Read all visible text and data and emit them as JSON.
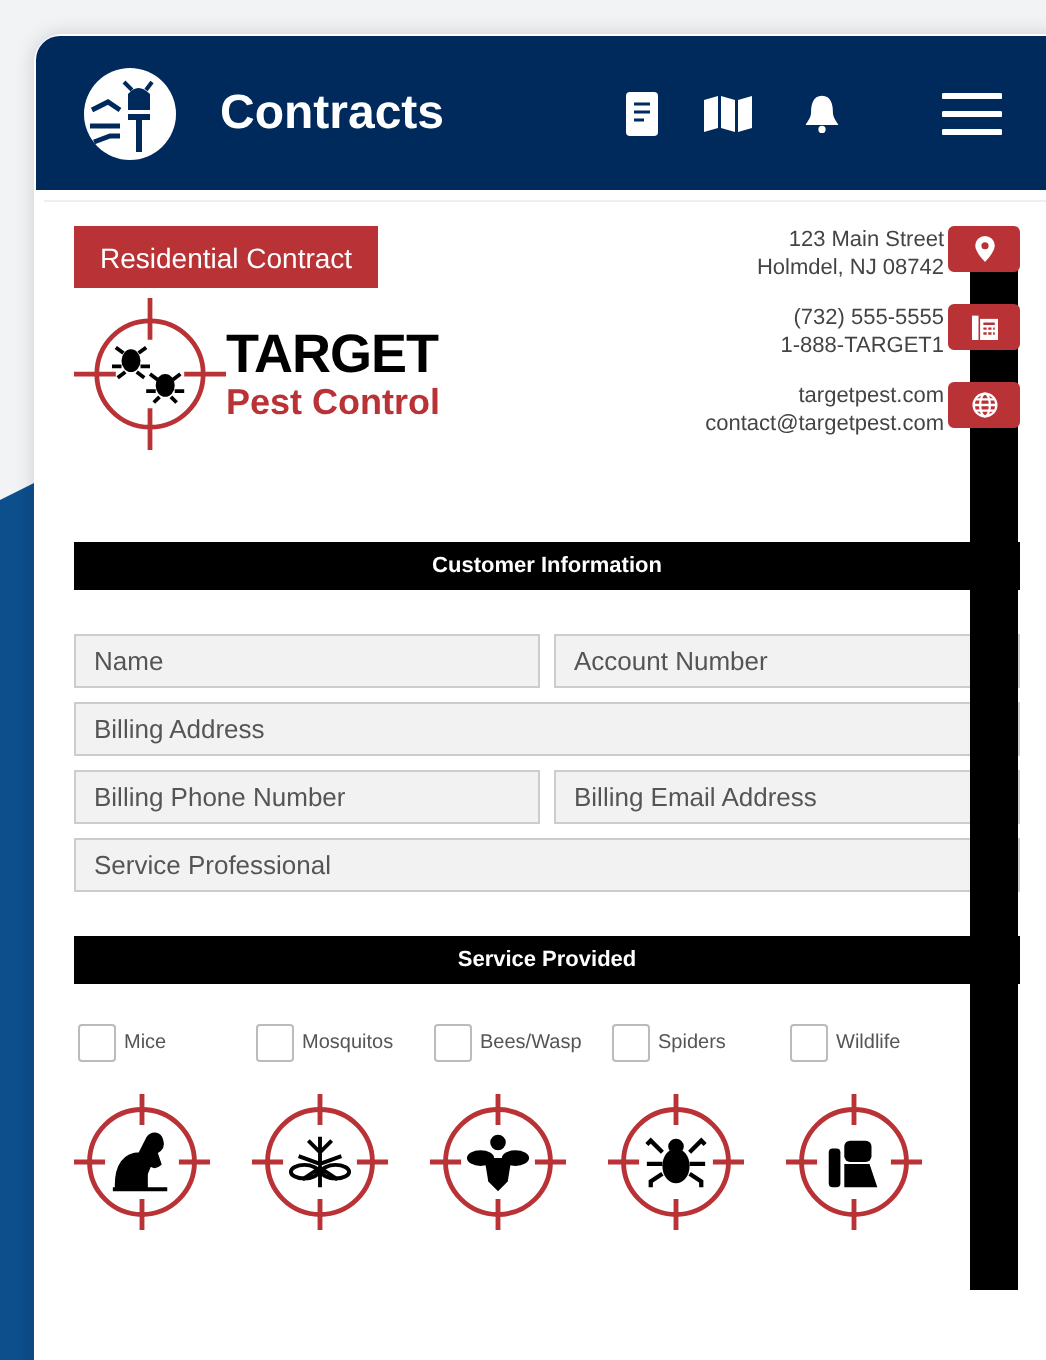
{
  "app_bar": {
    "title": "Contracts"
  },
  "contract_type": "Residential Contract",
  "brand": {
    "name": "TARGET",
    "tagline": "Pest Control"
  },
  "contacts": [
    {
      "kind": "address",
      "lines": [
        "123 Main Street",
        "Holmdel, NJ 08742"
      ]
    },
    {
      "kind": "phone",
      "lines": [
        "(732) 555-5555",
        "1-888-TARGET1"
      ]
    },
    {
      "kind": "web",
      "lines": [
        "targetpest.com",
        "contact@targetpest.com"
      ]
    }
  ],
  "customer_section": {
    "title": "Customer Information",
    "rows": [
      [
        {
          "placeholder": "Name"
        },
        {
          "placeholder": "Account Number"
        }
      ],
      [
        {
          "placeholder": "Billing Address"
        }
      ],
      [
        {
          "placeholder": "Billing Phone Number"
        },
        {
          "placeholder": "Billing Email Address"
        }
      ],
      [
        {
          "placeholder": "Service Professional"
        }
      ]
    ]
  },
  "services": {
    "title": "Service Provided",
    "items": [
      {
        "label": "Mice",
        "checked": false,
        "kind": "mouse"
      },
      {
        "label": "Mosquitos",
        "checked": false,
        "kind": "mosquito"
      },
      {
        "label": "Bees/Wasp",
        "checked": false,
        "kind": "bee"
      },
      {
        "label": "Spiders",
        "checked": false,
        "kind": "spider"
      },
      {
        "label": "Wildlife",
        "checked": false,
        "kind": "raccoon"
      }
    ]
  }
}
